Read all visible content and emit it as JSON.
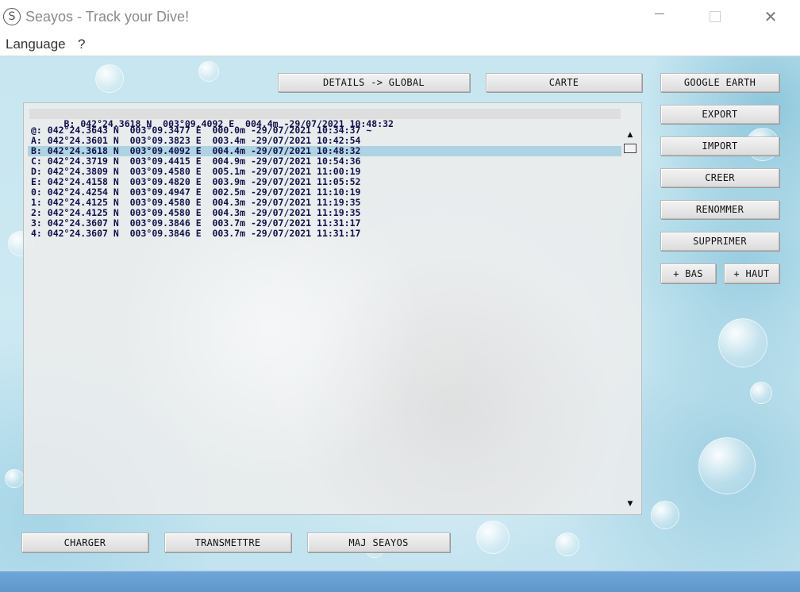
{
  "window": {
    "title": "Seayos - Track your Dive!",
    "logo_icon": "seayos-logo-icon",
    "controls": {
      "minimize": "minimize-icon",
      "maximize": "maximize-icon",
      "close": "✕"
    }
  },
  "menu": {
    "items": [
      "Language",
      "?"
    ]
  },
  "top_buttons": {
    "details": "DETAILS -> GLOBAL",
    "carte": "CARTE"
  },
  "side_buttons": {
    "google_earth": "GOOGLE EARTH",
    "export": "EXPORT",
    "import": "IMPORT",
    "creer": "CREER",
    "renommer": "RENOMMER",
    "supprimer": "SUPPRIMER",
    "bas": "+ BAS",
    "haut": "+ HAUT"
  },
  "bottom_buttons": {
    "charger": "CHARGER",
    "transmettre": "TRANSMETTRE",
    "maj": "MAJ SEAYOS"
  },
  "current_point": "B: 042°24.3618 N  003°09.4092 E  004.4m -29/07/2021 10:48:32",
  "points": [
    "@: 042°24.3643 N  003°09.3477 E  000.0m -29/07/2021 10:34:37 ~",
    "A: 042°24.3601 N  003°09.3823 E  003.4m -29/07/2021 10:42:54",
    "B: 042°24.3618 N  003°09.4092 E  004.4m -29/07/2021 10:48:32",
    "C: 042°24.3719 N  003°09.4415 E  004.9m -29/07/2021 10:54:36",
    "D: 042°24.3809 N  003°09.4580 E  005.1m -29/07/2021 11:00:19",
    "E: 042°24.4158 N  003°09.4820 E  003.9m -29/07/2021 11:05:52",
    "0: 042°24.4254 N  003°09.4947 E  002.5m -29/07/2021 11:10:19",
    "1: 042°24.4125 N  003°09.4580 E  004.3m -29/07/2021 11:19:35",
    "2: 042°24.4125 N  003°09.4580 E  004.3m -29/07/2021 11:19:35",
    "3: 042°24.3607 N  003°09.3846 E  003.7m -29/07/2021 11:31:17",
    "4: 042°24.3607 N  003°09.3846 E  003.7m -29/07/2021 11:31:17"
  ],
  "selected_index": 2,
  "scroll": {
    "up_icon": "▲",
    "down_icon": "▼"
  },
  "colors": {
    "selection": "#aed3e3",
    "statusbar": "#5f97cc",
    "text": "#11114a"
  }
}
